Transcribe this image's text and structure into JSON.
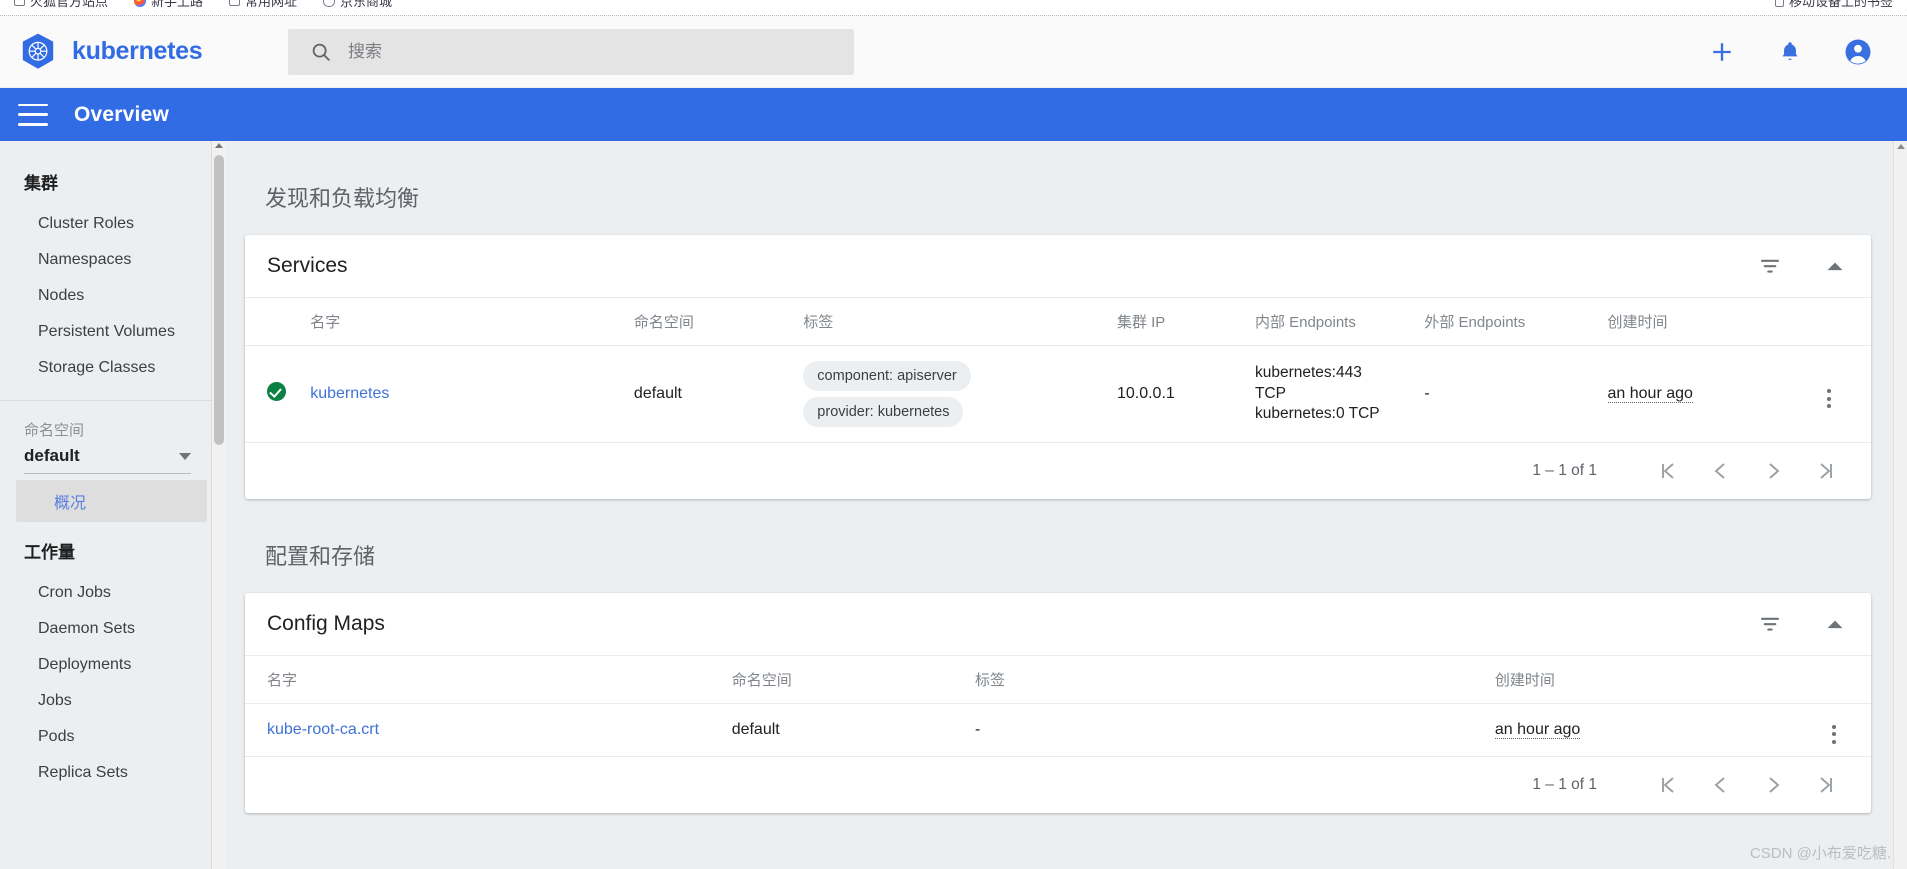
{
  "browser": {
    "bookmarks": [
      {
        "label": "火狐官方站点",
        "icon": "square-icon"
      },
      {
        "label": "新手上路",
        "icon": "firefox-icon"
      },
      {
        "label": "常用网址",
        "icon": "square-icon"
      },
      {
        "label": "京东商城",
        "icon": "shield-icon"
      }
    ],
    "bookmarks_right": {
      "label": "移动设备上的书签",
      "icon": "mobile-icon"
    }
  },
  "appbar": {
    "brand": "kubernetes",
    "search_placeholder": "搜索",
    "search_value": "",
    "actions": [
      {
        "name": "create-button",
        "icon": "plus-icon"
      },
      {
        "name": "notifications-button",
        "icon": "bell-icon"
      },
      {
        "name": "account-button",
        "icon": "account-circle-icon"
      }
    ],
    "accent": "#326ce5"
  },
  "subbar": {
    "title": "Overview",
    "menu_icon": "hamburger-icon"
  },
  "sidebar": {
    "cluster": {
      "header": "集群",
      "items": [
        {
          "label": "Cluster Roles"
        },
        {
          "label": "Namespaces"
        },
        {
          "label": "Nodes"
        },
        {
          "label": "Persistent Volumes"
        },
        {
          "label": "Storage Classes"
        }
      ]
    },
    "namespace": {
      "header": "命名空间",
      "selected": "default"
    },
    "overview": {
      "label": "概况",
      "active": true
    },
    "workloads": {
      "header": "工作量",
      "items": [
        {
          "label": "Cron Jobs"
        },
        {
          "label": "Daemon Sets"
        },
        {
          "label": "Deployments"
        },
        {
          "label": "Jobs"
        },
        {
          "label": "Pods"
        },
        {
          "label": "Replica Sets"
        }
      ]
    }
  },
  "main": {
    "sections": [
      {
        "title": "发现和负载均衡",
        "card": {
          "title": "Services",
          "filter_icon": "filter-funnel-icon",
          "collapse_icon": "chevron-up-icon",
          "columns": [
            "",
            "名字",
            "命名空间",
            "标签",
            "集群 IP",
            "内部 Endpoints",
            "外部 Endpoints",
            "创建时间",
            ""
          ],
          "rows": [
            {
              "status": "ok",
              "name": "kubernetes",
              "namespace": "default",
              "labels": [
                "component: apiserver",
                "provider: kubernetes"
              ],
              "cluster_ip": "10.0.0.1",
              "internal_endpoints": [
                "kubernetes:443",
                "TCP",
                "kubernetes:0 TCP"
              ],
              "external_endpoints": "-",
              "created": "an hour ago"
            }
          ],
          "pager": {
            "range": "1 – 1 of 1",
            "first": "|<",
            "prev": "<",
            "next": ">",
            "last": ">|"
          }
        }
      },
      {
        "title": "配置和存储",
        "card": {
          "title": "Config Maps",
          "filter_icon": "filter-funnel-icon",
          "collapse_icon": "chevron-up-icon",
          "columns": [
            "名字",
            "命名空间",
            "标签",
            "创建时间",
            ""
          ],
          "rows": [
            {
              "name": "kube-root-ca.crt",
              "namespace": "default",
              "labels": "-",
              "created": "an hour ago"
            }
          ],
          "pager": {
            "range": "1 – 1 of 1",
            "first": "|<",
            "prev": "<",
            "next": ">",
            "last": ">|"
          }
        }
      }
    ]
  },
  "watermark": "CSDN @小布爱吃糖."
}
